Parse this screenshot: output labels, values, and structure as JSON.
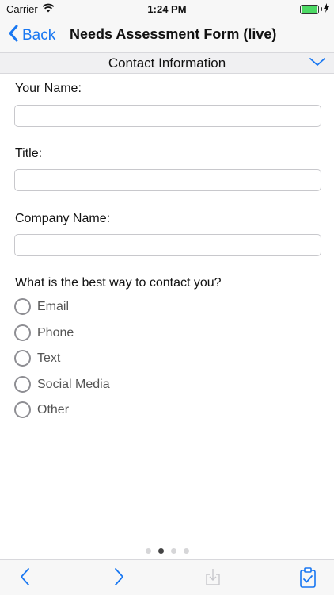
{
  "status_bar": {
    "carrier": "Carrier",
    "time": "1:24 PM",
    "battery_level": 1.0
  },
  "nav": {
    "back_label": "Back",
    "title": "Needs Assessment Form (live)"
  },
  "section": {
    "title": "Contact Information"
  },
  "form": {
    "name_label": "Your Name:",
    "name_value": "",
    "title_label": "Title:",
    "title_value": "",
    "company_label": "Company Name:",
    "company_value": "",
    "contact_question": "What is the best way to contact you?",
    "contact_options": [
      "Email",
      "Phone",
      "Text",
      "Social Media",
      "Other"
    ]
  },
  "pager": {
    "page_count": 4,
    "current_page": 2
  },
  "colors": {
    "accent": "#1877f2",
    "bar_background": "#f7f7f7",
    "battery": "#4cd964"
  },
  "icons": {
    "back": "chevron-left-icon",
    "section_toggle": "chevron-down-icon",
    "prev": "chevron-left-icon",
    "next": "chevron-right-icon",
    "save": "download-tray-icon",
    "submit": "clipboard-check-icon"
  }
}
